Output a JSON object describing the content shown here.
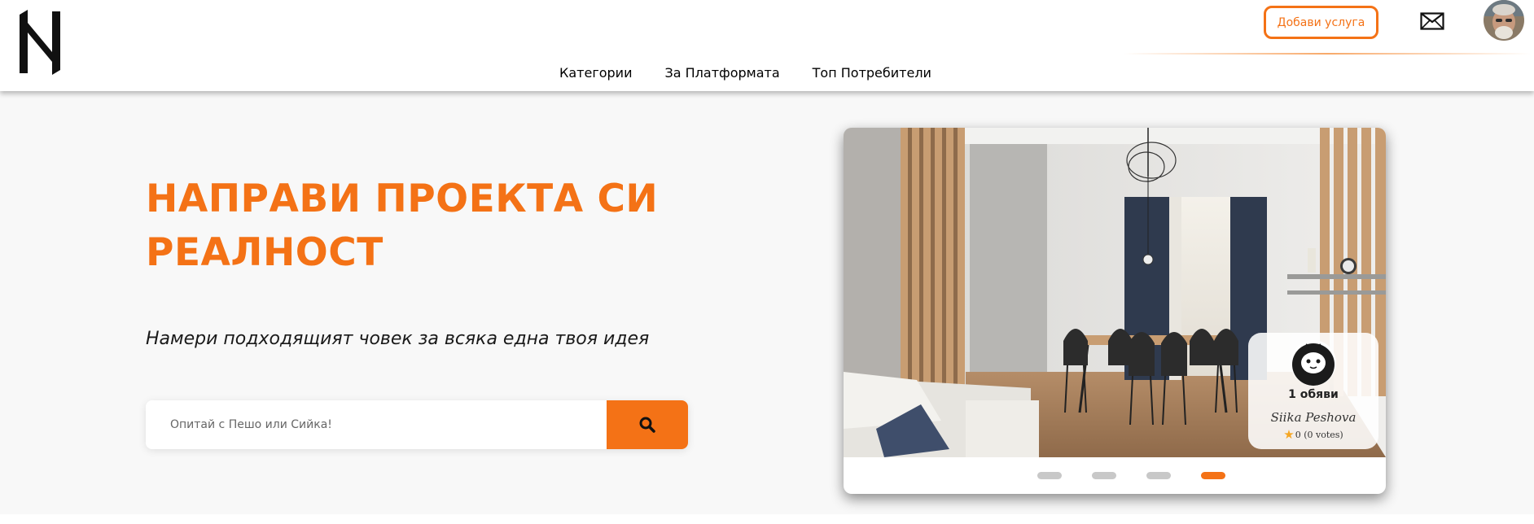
{
  "header": {
    "logo_letter": "N",
    "add_service_label": "Добави услуга",
    "mail_icon": "envelope-icon",
    "avatar": "user-avatar"
  },
  "nav": {
    "items": [
      {
        "label": "Категории"
      },
      {
        "label": "За Платформата"
      },
      {
        "label": "Топ Потребители"
      }
    ]
  },
  "hero": {
    "title": "НАПРАВИ ПРОЕКТА СИ РЕАЛНОСТ",
    "subtitle": "Намери подходящият човек за всяка една твоя идея",
    "search_placeholder": "Опитай с Пешо или Сийка!",
    "search_icon": "search-icon"
  },
  "carousel": {
    "slide_count": 4,
    "active_slide": 4,
    "profile": {
      "ads": "1 обяви",
      "name": "Siika Peshova",
      "rating_text": "0 (0 votes)"
    }
  },
  "colors": {
    "accent": "#f47216",
    "hero_bg": "#f8f8f8",
    "dot_inactive": "#c8c8c8"
  }
}
